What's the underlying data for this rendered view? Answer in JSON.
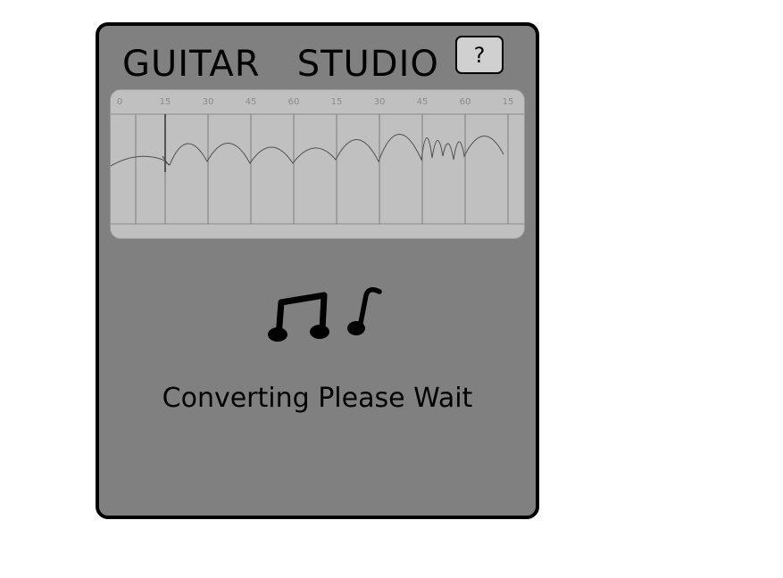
{
  "app": {
    "title": "GUITAR   STUDIO"
  },
  "help_button": {
    "label": "?"
  },
  "waveform": {
    "time_ticks": [
      "0",
      "15",
      "30",
      "45",
      "60",
      "15",
      "30",
      "45",
      "60",
      "15"
    ]
  },
  "icons": {
    "status": "music-notes-icon"
  },
  "status": {
    "message": "Converting Please Wait"
  },
  "colors": {
    "device_body": "#808080",
    "waveform_background": "#c0c0c0",
    "help_button": "#d0d0d0",
    "border": "#000000"
  }
}
